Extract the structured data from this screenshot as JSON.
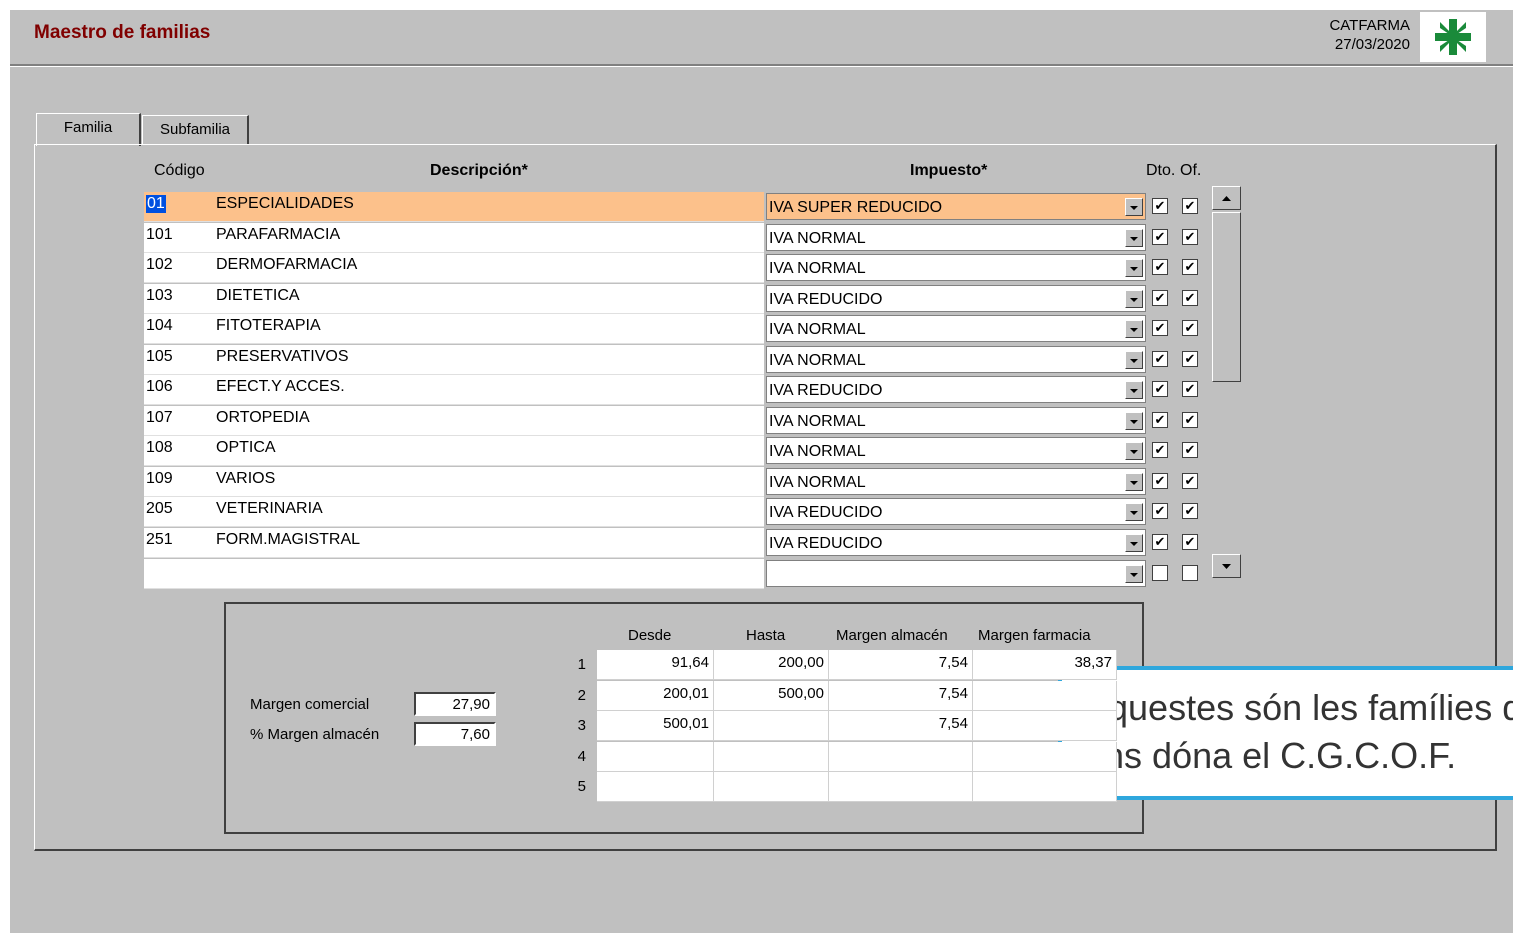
{
  "header": {
    "title": "Maestro de familias",
    "company": "CATFARMA",
    "date": "27/03/2020",
    "logo_icon": "pharmacy-cross-icon"
  },
  "tabs": [
    {
      "label": "Familia",
      "active": true
    },
    {
      "label": "Subfamilia",
      "active": false
    }
  ],
  "columns": {
    "code": "Código",
    "description": "Descripción*",
    "tax": "Impuesto*",
    "dto": "Dto.",
    "of": "Of."
  },
  "rows": [
    {
      "code": "01",
      "description": "ESPECIALIDADES",
      "tax": "IVA SUPER REDUCIDO",
      "dto": true,
      "of": true
    },
    {
      "code": "101",
      "description": "PARAFARMACIA",
      "tax": "IVA NORMAL",
      "dto": true,
      "of": true
    },
    {
      "code": "102",
      "description": "DERMOFARMACIA",
      "tax": "IVA NORMAL",
      "dto": true,
      "of": true
    },
    {
      "code": "103",
      "description": "DIETETICA",
      "tax": "IVA REDUCIDO",
      "dto": true,
      "of": true
    },
    {
      "code": "104",
      "description": "FITOTERAPIA",
      "tax": "IVA NORMAL",
      "dto": true,
      "of": true
    },
    {
      "code": "105",
      "description": "PRESERVATIVOS",
      "tax": "IVA NORMAL",
      "dto": true,
      "of": true
    },
    {
      "code": "106",
      "description": "EFECT.Y ACCES.",
      "tax": "IVA REDUCIDO",
      "dto": true,
      "of": true
    },
    {
      "code": "107",
      "description": "ORTOPEDIA",
      "tax": "IVA NORMAL",
      "dto": true,
      "of": true
    },
    {
      "code": "108",
      "description": "OPTICA",
      "tax": "IVA NORMAL",
      "dto": true,
      "of": true
    },
    {
      "code": "109",
      "description": "VARIOS",
      "tax": "IVA NORMAL",
      "dto": true,
      "of": true
    },
    {
      "code": "205",
      "description": "VETERINARIA",
      "tax": "IVA REDUCIDO",
      "dto": true,
      "of": true
    },
    {
      "code": "251",
      "description": "FORM.MAGISTRAL",
      "tax": "IVA REDUCIDO",
      "dto": true,
      "of": true
    },
    {
      "code": "",
      "description": "",
      "tax": "",
      "dto": false,
      "of": false
    }
  ],
  "margins": {
    "headers": {
      "from": "Desde",
      "to": "Hasta",
      "warehouse": "Margen almacén",
      "pharmacy": "Margen farmacia"
    },
    "rows": [
      {
        "n": "1",
        "from": "91,64",
        "to": "200,00",
        "warehouse": "7,54",
        "pharmacy": "38,37"
      },
      {
        "n": "2",
        "from": "200,01",
        "to": "500,00",
        "warehouse": "7,54",
        "pharmacy": ""
      },
      {
        "n": "3",
        "from": "500,01",
        "to": "",
        "warehouse": "7,54",
        "pharmacy": ""
      },
      {
        "n": "4",
        "from": "",
        "to": "",
        "warehouse": "",
        "pharmacy": ""
      },
      {
        "n": "5",
        "from": "",
        "to": "",
        "warehouse": "",
        "pharmacy": ""
      }
    ],
    "commercial_label": "Margen comercial",
    "commercial_value": "27,90",
    "warehouse_pct_label": "% Margen almacén",
    "warehouse_pct_value": "7,60"
  },
  "callout": {
    "line1": "Aquestes són les famílies que",
    "line2": "ens dóna el C.G.C.O.F."
  }
}
